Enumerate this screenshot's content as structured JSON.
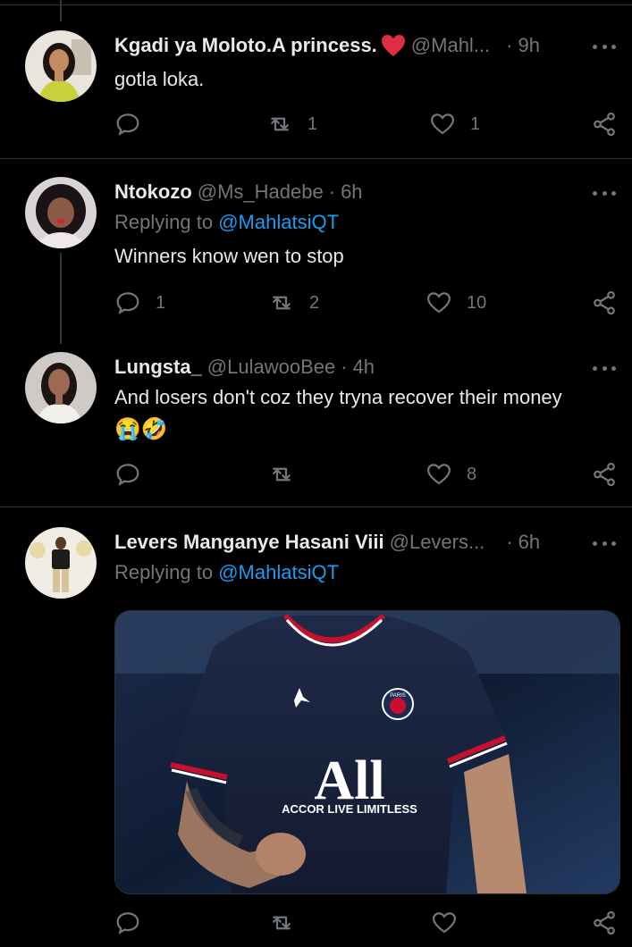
{
  "tweets": [
    {
      "name": "Kgadi ya Moloto.A princess.",
      "name_emoji": "❤️",
      "handle": "@Mahl...",
      "time": "9h",
      "body": "gotla loka.",
      "reply_count": "",
      "retweet_count": "1",
      "like_count": "1"
    },
    {
      "name": "Ntokozo",
      "handle": "@Ms_Hadebe",
      "time": "6h",
      "replying_prefix": "Replying to",
      "replying_to": "@MahlatsiQT",
      "body": "Winners know wen to stop",
      "reply_count": "1",
      "retweet_count": "2",
      "like_count": "10"
    },
    {
      "name": "Lungsta_",
      "handle": "@LulawooBee",
      "time": "4h",
      "body": "And losers don't coz they tryna recover their money",
      "body_emojis": "😭🤣",
      "reply_count": "",
      "retweet_count": "",
      "like_count": "8"
    },
    {
      "name": "Levers Manganye Hasani Viii",
      "handle": "@Levers...",
      "time": "6h",
      "replying_prefix": "Replying to",
      "replying_to": "@MahlatsiQT",
      "media": {
        "jersey_text": "ACCOR LIVE LIMITLESS",
        "jersey_logo": "All",
        "badge": "PARIS"
      },
      "reply_count": "",
      "retweet_count": "",
      "like_count": ""
    }
  ],
  "colors": {
    "background": "#000000",
    "text": "#e7e9ea",
    "secondary": "#71767b",
    "link": "#1d9bf0",
    "divider": "#2f3336"
  }
}
